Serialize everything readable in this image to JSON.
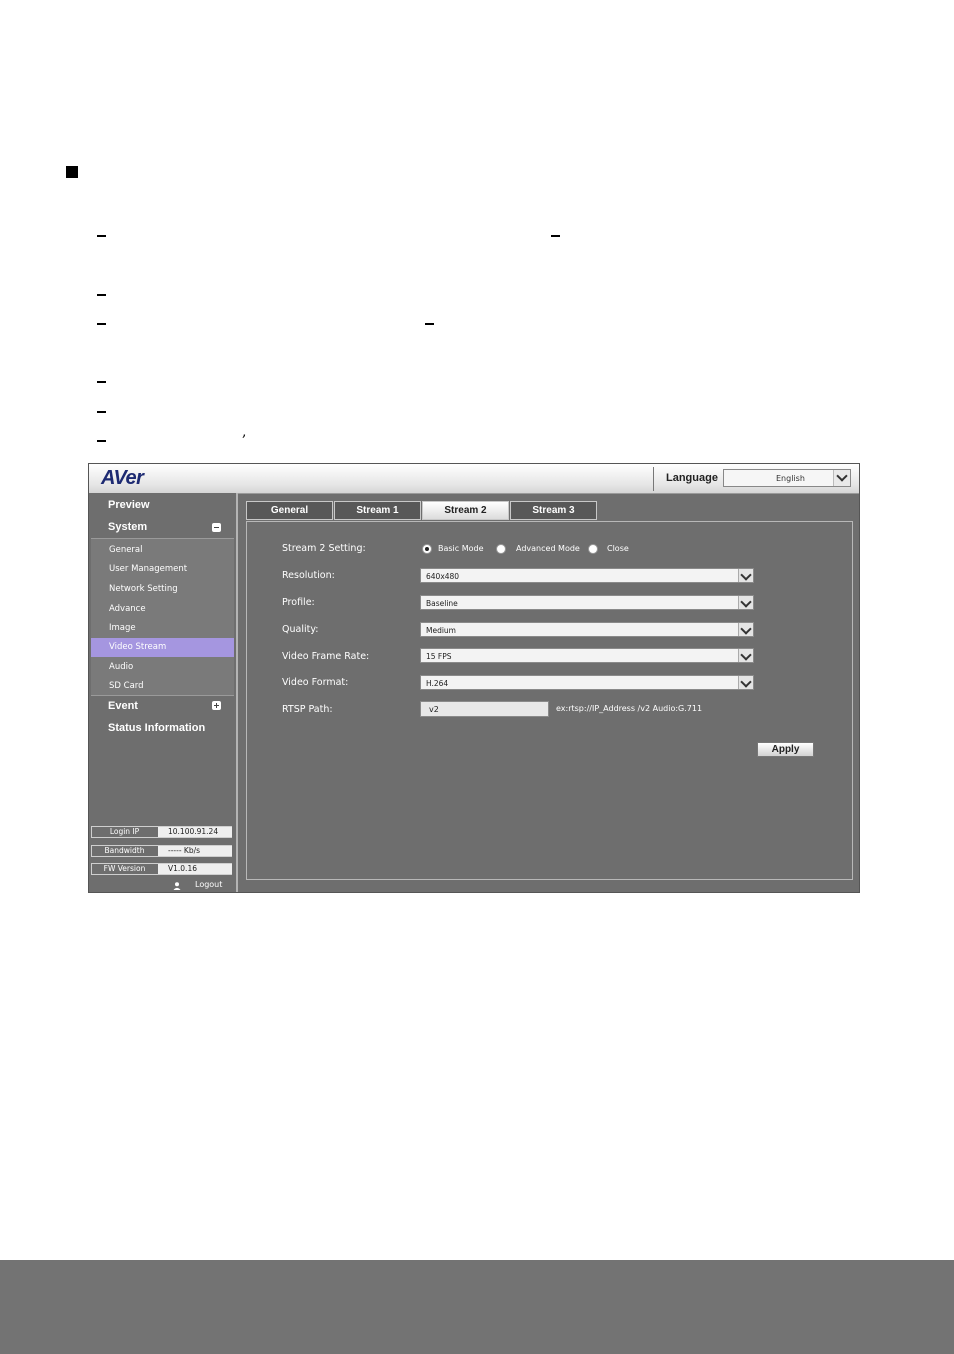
{
  "topbar": {
    "logo": "AVer",
    "language_label": "Language",
    "language_value": "English"
  },
  "sidebar": {
    "preview": "Preview",
    "system": "System",
    "system_items": [
      "General",
      "User Management",
      "Network Setting",
      "Advance",
      "Image",
      "Video Stream",
      "Audio",
      "SD Card"
    ],
    "active_item": "Video Stream",
    "event": "Event",
    "status": "Status Information",
    "info": {
      "login_ip_label": "Login IP",
      "login_ip_value": "10.100.91.24",
      "bandwidth_label": "Bandwidth",
      "bandwidth_value": "----- Kb/s",
      "fw_label": "FW Version",
      "fw_value": "V1.0.16"
    },
    "logout": "Logout"
  },
  "tabs": [
    "General",
    "Stream 1",
    "Stream 2",
    "Stream 3"
  ],
  "active_tab": "Stream 2",
  "form": {
    "setting_label": "Stream 2 Setting:",
    "modes": [
      "Basic Mode",
      "Advanced Mode",
      "Close"
    ],
    "selected_mode": "Basic Mode",
    "resolution_label": "Resolution:",
    "resolution_value": "640x480",
    "profile_label": "Profile:",
    "profile_value": "Baseline",
    "quality_label": "Quality:",
    "quality_value": "Medium",
    "frame_rate_label": "Video Frame Rate:",
    "frame_rate_value": "15 FPS",
    "format_label": "Video Format:",
    "format_value": "H.264",
    "rtsp_label": "RTSP Path:",
    "rtsp_value": "v2",
    "rtsp_hint": "ex:rtsp://IP_Address /v2   Audio:G.711",
    "apply": "Apply"
  },
  "page": {
    "comma": ","
  }
}
